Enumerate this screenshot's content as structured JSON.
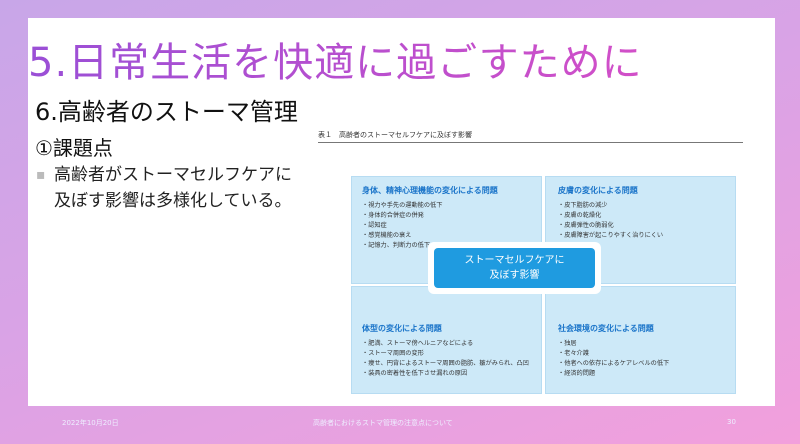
{
  "title": "5.日常生活を快適に過ごすために",
  "subtitle": "6.高齢者のストーマ管理",
  "heading": "①課題点",
  "bullet": "高齢者がストーマセルフケアに及ぼす影響は多様化している。",
  "figure": {
    "caption": "表１　高齢者のストーマセルフケアに及ぼす影響",
    "center": [
      "ストーマセルフケアに",
      "及ぼす影響"
    ],
    "panels": [
      {
        "title": "身体、精神心理機能の変化による問題",
        "items": [
          "視力や手先の運動能の低下",
          "身体的合併症の併発",
          "認知症",
          "感覚機能の衰え",
          "記憶力、判断力の低下"
        ]
      },
      {
        "title": "皮膚の変化による問題",
        "items": [
          "皮下脂肪の減少",
          "皮膚の乾燥化",
          "皮膚弾性の脆弱化",
          "皮膚障害が起こりやすく治りにくい"
        ]
      },
      {
        "title": "体型の変化による問題",
        "items": [
          "肥満、ストーマ傍ヘルニアなどによる",
          "ストーマ周囲の変形",
          "痩せ、円背によるストーマ周囲の脂肪、皺がみられ、凸凹",
          "装具の密着性を低下させ漏れの原因"
        ]
      },
      {
        "title": "社会環境の変化による問題",
        "items": [
          "独居",
          "老々介護",
          "他者への依存によるケアレベルの低下",
          "経済的問題"
        ]
      }
    ]
  },
  "footer": {
    "date": "2022年10月20日",
    "center": "高齢者におけるストマ管理の注意点について",
    "page": "30"
  }
}
